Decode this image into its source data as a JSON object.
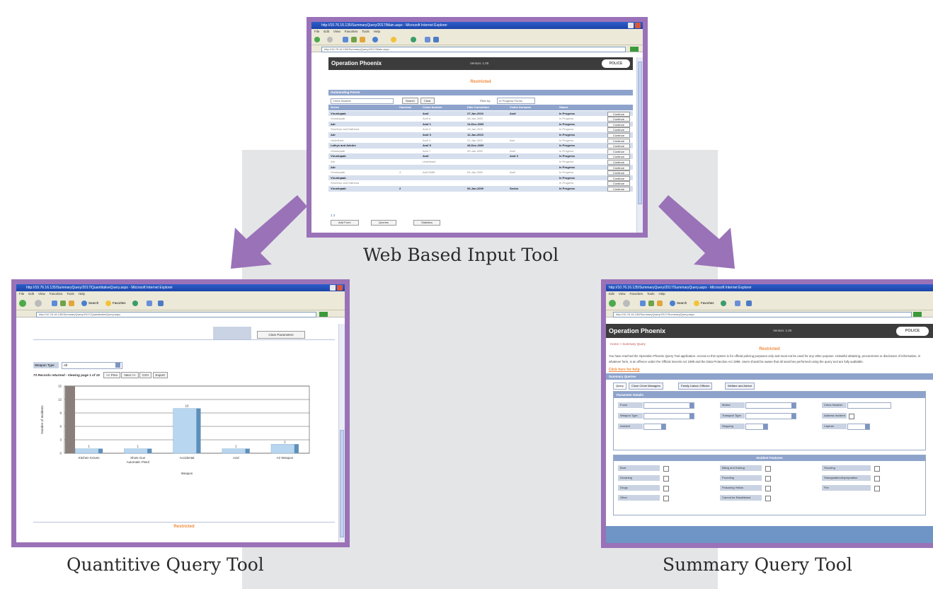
{
  "captions": {
    "top": "Web Based Input Tool",
    "left": "Quantitive Query Tool",
    "right": "Summary Query Tool"
  },
  "colors": {
    "frame": "#9a72b8",
    "arrow": "#9a72b8",
    "background_panel": "#e4e5e7",
    "app_header": "#3c3c3c",
    "accent_orange": "#f08a3c",
    "band_blue": "#8da3cc"
  },
  "top_screen": {
    "window_title": "http://10.76.16.135/SummaryQuery/2017/Main.aspx - Microsoft Internet Explorer",
    "menu": [
      "File",
      "Edit",
      "View",
      "Favorites",
      "Tools",
      "Help"
    ],
    "address": "http://10.76.16.135/SummaryQuery/2017/Main.aspx",
    "app_title": "Operation Phoenix",
    "version": "Version: 1.00",
    "logo_text": "POLICE",
    "restricted": "Restricted",
    "panel_title": "Outstanding Forms",
    "crime_label": "Crime Number",
    "search_button": "Search",
    "clear_button": "Clear",
    "filter_label": "Filter by:",
    "filter_value": "In Progress Forms",
    "columns": [
      "Series",
      "Cameras",
      "Crime Number",
      "Date Committed",
      "Victim Surname",
      "Status",
      ""
    ],
    "row_button": "Continue",
    "rows": [
      {
        "style": "bold",
        "series": "Virushqaab",
        "cameras": "",
        "crime": "Avd/",
        "date": "27-Jan-2010",
        "victim": "Asd/",
        "status": "In Progress"
      },
      {
        "style": "light",
        "series": "Virushqaab",
        "cameras": "",
        "crime": "Avd/ a",
        "date": "28-Jan-2009",
        "victim": "",
        "status": "In Progress"
      },
      {
        "style": "bold",
        "series": "Adr",
        "cameras": "",
        "crime": "Avd/ 1",
        "date": "14-Dec-2009",
        "victim": "",
        "status": "In Progress"
      },
      {
        "style": "light",
        "series": "Shorthou and Dathena",
        "cameras": "",
        "crime": "Avd/ 2",
        "date": "13-Jan-2010",
        "victim": "",
        "status": "In Progress"
      },
      {
        "style": "bold",
        "series": "Adr",
        "cameras": "",
        "crime": "Avd/ 3",
        "date": "12-Jan-2010",
        "victim": "",
        "status": "In Progress"
      },
      {
        "style": "light",
        "series": "Undefined",
        "cameras": "",
        "crime": "Avd/ 4",
        "date": "21-Jan-2010",
        "victim": "Asd",
        "status": "In Progress"
      },
      {
        "style": "bold",
        "series": "Lathys and Adedre",
        "cameras": "",
        "crime": "Avd/ 5",
        "date": "28-Dec-2009",
        "victim": "",
        "status": "In Progress"
      },
      {
        "style": "light",
        "series": "Virushqaab",
        "cameras": "",
        "crime": "Avd/ 7",
        "date": "09-Jan-2009",
        "victim": "Asd/",
        "status": "In Progress"
      },
      {
        "style": "bold",
        "series": "Virushqaab",
        "cameras": "",
        "crime": "Avd/",
        "date": "",
        "victim": "Avd/ 3",
        "status": "In Progress"
      },
      {
        "style": "light",
        "series": "Adr",
        "cameras": "",
        "crime": "Undefined",
        "date": "",
        "victim": "",
        "status": "In Progress"
      },
      {
        "style": "bold",
        "series": "Adr",
        "cameras": "",
        "crime": "",
        "date": "",
        "victim": "",
        "status": "In Progress"
      },
      {
        "style": "light",
        "series": "Virushqaab",
        "cameras": "4",
        "crime": "Adr23456",
        "date": "04-Jan-2009",
        "victim": "Asd/",
        "status": "In Progress"
      },
      {
        "style": "bold",
        "series": "Virushqaab",
        "cameras": "",
        "crime": "",
        "date": "",
        "victim": "",
        "status": "In Progress"
      },
      {
        "style": "light",
        "series": "Shorthou and Dathena",
        "cameras": "",
        "crime": "",
        "date": "",
        "victim": "",
        "status": "In Progress"
      },
      {
        "style": "bold",
        "series": "Virushqaab",
        "cameras": "2",
        "crime": "",
        "date": "06-Jan-2009",
        "victim": "Sector",
        "status": "In Progress"
      }
    ],
    "pager": "1 2",
    "footer_tabs": [
      "Add Form",
      "Queries",
      "Statistics"
    ]
  },
  "left_screen": {
    "window_title": "http://10.76.16.135/SummaryQuery/2017/QuantitativeQuery.aspx - Microsoft Internet Explorer",
    "menu": [
      "File",
      "Edit",
      "View",
      "Favorites",
      "Tools",
      "Help"
    ],
    "toolbar_search": "Search",
    "toolbar_favorites": "Favorites",
    "address": "http://10.76.16.135/SummaryQuery/2017/QuantitativeQuery.aspx",
    "clear_button": "Clear Parameters",
    "filter_label": "Weapon Type",
    "filter_value": "All",
    "records_text": "73 Records returned - Viewing page 1 of 15",
    "prev_button": "<< Prev",
    "next_button": "Next >>",
    "csv_button": "CSV",
    "export_button": "Export",
    "restricted": "Restricted"
  },
  "chart_data": {
    "type": "bar",
    "categories": [
      "Kitchen Knives",
      "Shots Gun Automatic Pistol",
      "Accidental",
      "Acid",
      "Air Weapon"
    ],
    "values": [
      1,
      1,
      10,
      1,
      2
    ],
    "extra_bar_value": 15,
    "ylabel": "Number of Incidents",
    "xlabel": "Weapon",
    "ylim": [
      0,
      15
    ],
    "yticks": [
      15,
      12,
      9,
      6,
      3,
      0
    ],
    "grid": true
  },
  "right_screen": {
    "window_title": "http://10.76.16.135/SummaryQuery/2017/SummaryQuery.aspx - Microsoft Internet Explorer",
    "menu": [
      "Edit",
      "View",
      "Favorites",
      "Tools",
      "Help"
    ],
    "toolbar_search": "Search",
    "toolbar_favorites": "Favorites",
    "address": "http://10.76.16.135/SummaryQuery/2017/SummaryQuery.aspx",
    "app_title": "Operation Phoenix",
    "version": "Version: 1.00",
    "logo_text": "POLICE",
    "breadcrumb": "Home > Summary Query",
    "restricted": "Restricted",
    "notice": "You have reached the Operation Phoenix Query Tool application. Access to this system is for official policing purposes only and must not be used for any other purpose. Unlawful obtaining, procurement or disclosure of information, in whatever form, is an offence under the Official Secrets Act 1989 and the Data Protection Act 1998. Users should be aware that all searches performed using the query tool are fully auditable.",
    "link": "Click here for help",
    "panel_title": "Summary Queries",
    "tabs": [
      "Query",
      "Close Crime Managers",
      "Family Liaison Officers",
      "Welfare and Advice"
    ],
    "section_title": "Parameter Details",
    "fields": [
      {
        "label": "Force",
        "type": "select"
      },
      {
        "label": "Motive",
        "type": "select"
      },
      {
        "label": "Crime Number",
        "type": "input"
      },
      {
        "label": "Weapon Type",
        "type": "select"
      },
      {
        "label": "Transport Type",
        "type": "select"
      },
      {
        "label": "Address Incident",
        "type": "check"
      },
      {
        "label": "Incident",
        "type": "select"
      },
      {
        "label": "Stopping",
        "type": "select"
      },
      {
        "label": "Capture",
        "type": "select"
      }
    ],
    "subsection_title": "Incident Features",
    "checks": [
      [
        "Boot",
        "Biting and Kicking",
        "Shooting"
      ],
      [
        "Drowning",
        "Pounding",
        "Strangulation/Asphyxiation"
      ],
      [
        "Drugs",
        "Poisoning Yellow",
        "Fire"
      ],
      [
        "Other",
        "Cannot be Established",
        ""
      ]
    ]
  }
}
